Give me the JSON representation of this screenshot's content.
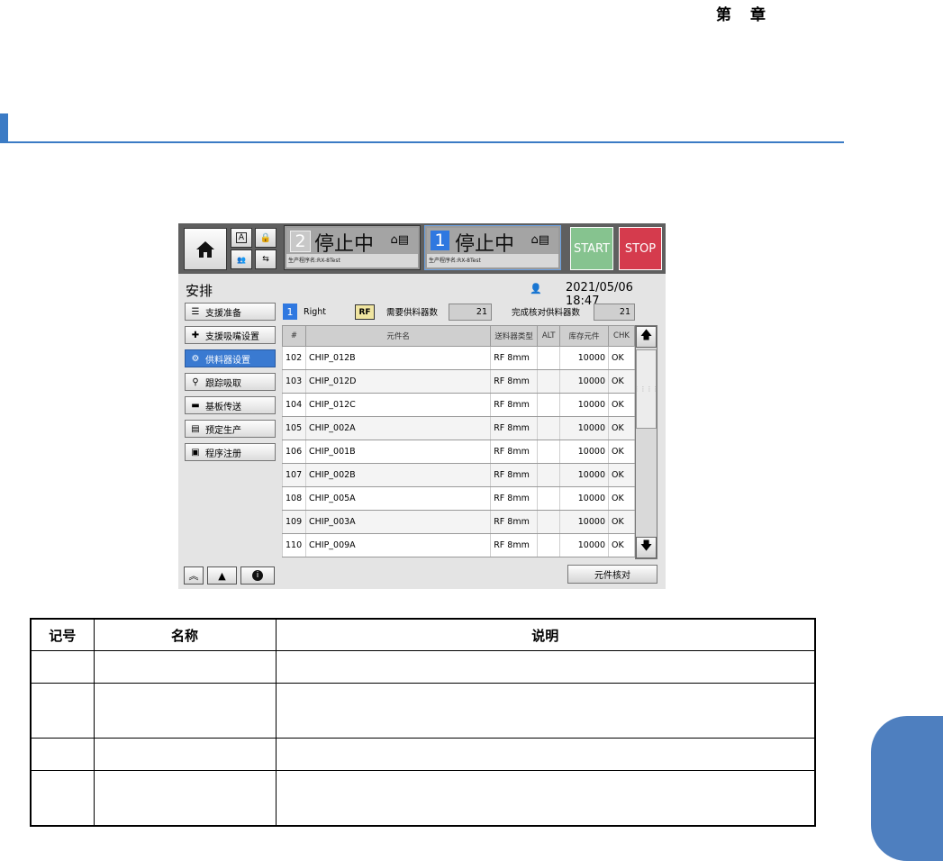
{
  "header": {
    "chapter": "第　章"
  },
  "screen": {
    "lanes": [
      {
        "number": "2",
        "status": "停止中",
        "program": "生产程序名:RX-8Test"
      },
      {
        "number": "1",
        "status": "停止中",
        "program": "生产程序名:RX-8Test"
      }
    ],
    "start_label": "START",
    "stop_label": "STOP",
    "title": "安排",
    "datetime": "2021/05/06 18:47",
    "menu": [
      {
        "label": "支援准备",
        "icon": "checklist-icon"
      },
      {
        "label": "支援吸嘴设置",
        "icon": "nozzle-icon"
      },
      {
        "label": "供料器设置",
        "icon": "feeder-icon",
        "active": true
      },
      {
        "label": "跟踪吸取",
        "icon": "trace-icon"
      },
      {
        "label": "基板传送",
        "icon": "conveyor-icon"
      },
      {
        "label": "预定生产",
        "icon": "clipboard-icon"
      },
      {
        "label": "程序注册",
        "icon": "register-icon"
      }
    ],
    "lane_indicator": "1",
    "lane_side": "Right",
    "rf_badge": "RF",
    "required_label": "需要供料器数",
    "required_value": "21",
    "completed_label": "完成核对供料器数",
    "completed_value": "21",
    "table": {
      "headers": [
        "#",
        "元件名",
        "送料器类型",
        "ALT",
        "库存元件",
        "CHK"
      ],
      "rows": [
        [
          "102",
          "CHIP_012B",
          "RF 8mm",
          "",
          "10000",
          "OK"
        ],
        [
          "103",
          "CHIP_012D",
          "RF 8mm",
          "",
          "10000",
          "OK"
        ],
        [
          "104",
          "CHIP_012C",
          "RF 8mm",
          "",
          "10000",
          "OK"
        ],
        [
          "105",
          "CHIP_002A",
          "RF 8mm",
          "",
          "10000",
          "OK"
        ],
        [
          "106",
          "CHIP_001B",
          "RF 8mm",
          "",
          "10000",
          "OK"
        ],
        [
          "107",
          "CHIP_002B",
          "RF 8mm",
          "",
          "10000",
          "OK"
        ],
        [
          "108",
          "CHIP_005A",
          "RF 8mm",
          "",
          "10000",
          "OK"
        ],
        [
          "109",
          "CHIP_003A",
          "RF 8mm",
          "",
          "10000",
          "OK"
        ],
        [
          "110",
          "CHIP_009A",
          "RF 8mm",
          "",
          "10000",
          "OK"
        ]
      ]
    },
    "check_button": "元件核对"
  },
  "legend": {
    "headers": [
      "记号",
      "名称",
      "说明"
    ],
    "rows": [
      [
        "",
        "",
        ""
      ],
      [
        "",
        "",
        ""
      ],
      [
        "",
        "",
        ""
      ],
      [
        "",
        "",
        ""
      ]
    ]
  }
}
